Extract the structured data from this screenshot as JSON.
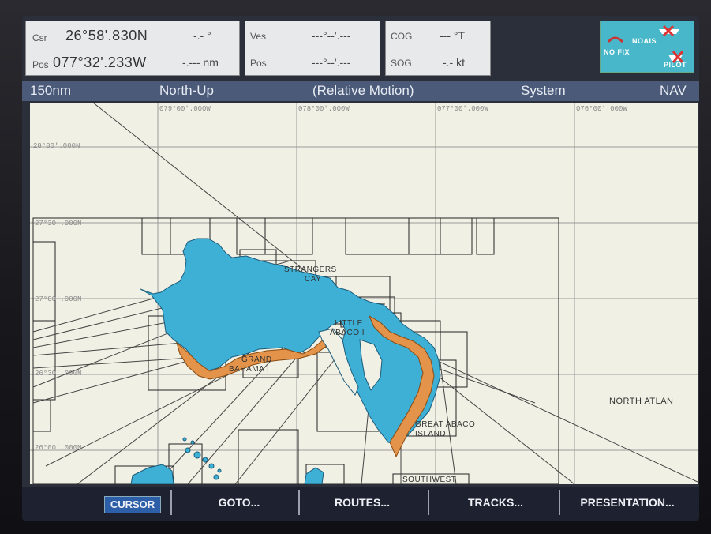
{
  "header": {
    "csr_label": "Csr",
    "csr_lat": "26°58'.830N",
    "csr_bearing": "-.- °",
    "pos_label": "Pos",
    "pos_lon": "077°32'.233W",
    "pos_range": "-.--- nm",
    "ves_label": "Ves",
    "ves_value": "---°--'.---",
    "pos2_label": "Pos",
    "pos2_value": "---°--'.---",
    "cog_label": "COG",
    "cog_value": "--- °T",
    "sog_label": "SOG",
    "sog_value": "-.- kt"
  },
  "logo": {
    "noais": "NOAIS",
    "nofix": "NO FIX",
    "pilot": "PILOT"
  },
  "status": {
    "range": "150nm",
    "orientation": "North-Up",
    "motion": "(Relative Motion)",
    "mode": "System",
    "nav": "NAV"
  },
  "chart": {
    "lon_labels": [
      "079°00'.000W",
      "078°00'.000W",
      "077°00'.000W",
      "076°00'.000W"
    ],
    "lat_labels": [
      "28°00'.000N",
      "27°30'.000N",
      "27°00'.000N",
      "26°30'.000N",
      "26°00'.000N"
    ],
    "places": {
      "strangers_cay_1": "STRANGERS",
      "strangers_cay_2": "CAY",
      "little_abaco_1": "LITTLE",
      "little_abaco_2": "ABACO I",
      "grand_bahama_1": "GRAND",
      "grand_bahama_2": "BAHAMA I",
      "great_abaco_1": "GREAT ABACO",
      "great_abaco_2": "ISLAND",
      "north_atlantic": "NORTH ATLAN",
      "southwest": "SOUTHWEST"
    }
  },
  "softkeys": {
    "cursor": "CURSOR",
    "goto": "GOTO...",
    "routes": "ROUTES...",
    "tracks": "TRACKS...",
    "presentation": "PRESENTATION..."
  },
  "colors": {
    "land_blue": "#3eb0d6",
    "land_orange": "#e3944a",
    "chart_bg": "#f1f0e4",
    "statusbar": "#4a5a78"
  }
}
